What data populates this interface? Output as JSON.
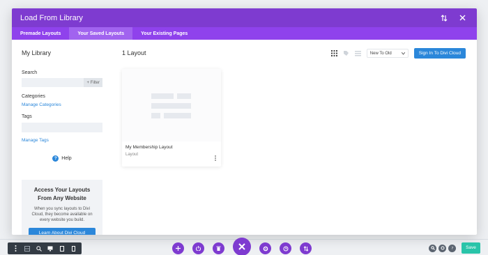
{
  "modal": {
    "title": "Load From Library",
    "tabs": [
      {
        "label": "Premade Layouts"
      },
      {
        "label": "Your Saved Layouts"
      },
      {
        "label": "Your Existing Pages"
      }
    ]
  },
  "sidebar": {
    "title": "My Library",
    "search_label": "Search",
    "filter_label": "+ Filter",
    "categories_label": "Categories",
    "manage_categories": "Manage Categories",
    "tags_label": "Tags",
    "manage_tags": "Manage Tags",
    "help_label": "Help",
    "cloud": {
      "title": "Access Your Layouts From Any Website",
      "text": "When you sync layouts to Divi Cloud, they become available on every website you build.",
      "button": "Learn About Divi Cloud"
    }
  },
  "main": {
    "count_label": "1 Layout",
    "sort_value": "New To Old",
    "signin_button": "Sign In To Divi Cloud",
    "layouts": [
      {
        "name": "My Membership Layout",
        "type": "Layout"
      }
    ]
  },
  "footer": {
    "save_label": "Save"
  },
  "colors": {
    "header_purple": "#7e3bd0",
    "tab_purple": "#8f42ec",
    "accent_blue": "#2b87da",
    "save_green": "#29c4a9"
  }
}
